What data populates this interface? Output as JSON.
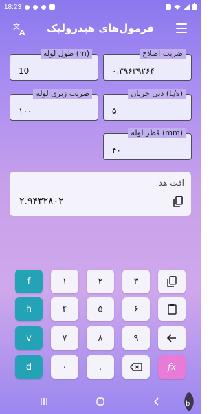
{
  "status_bar": {
    "time": "18:23",
    "icons": [
      "notification-icon",
      "app-icon",
      "info-icon",
      "network-speed-icon",
      "battery-icon",
      "mute-icon",
      "signal-icon",
      "wifi-icon"
    ]
  },
  "app_bar": {
    "title": "فرمول‌های هیدرولیک"
  },
  "fields": {
    "correction_factor": {
      "label": "ضریب اصلاح",
      "value": "۰.۳۹۶۳۹۲۶۴"
    },
    "pipe_length": {
      "label": "طول لوله (m)",
      "value": "10"
    },
    "flow_rate": {
      "label": "دبی جریان (L/s)",
      "value": "۵"
    },
    "roughness": {
      "label": "ضریب زبری لوله",
      "value": "۱۰۰"
    },
    "pipe_diameter": {
      "label": "قطر لوله (mm)",
      "value": "۴۰"
    }
  },
  "result": {
    "title": "افت هد",
    "value": "۲.۹۴۳۲۸۰۲"
  },
  "keypad": {
    "keys": {
      "f": "f",
      "h": "h",
      "v": "v",
      "d": "d",
      "k1": "۱",
      "k2": "۲",
      "k3": "۳",
      "k4": "۴",
      "k5": "۵",
      "k6": "۶",
      "k7": "۷",
      "k8": "۸",
      "k9": "۹",
      "k0": "۰",
      "dot": ".",
      "fx": "fx"
    }
  },
  "colors": {
    "accent_teal": "#24a2b6",
    "accent_pink": "#e87ad8",
    "field_bg": "#ecebfb"
  }
}
